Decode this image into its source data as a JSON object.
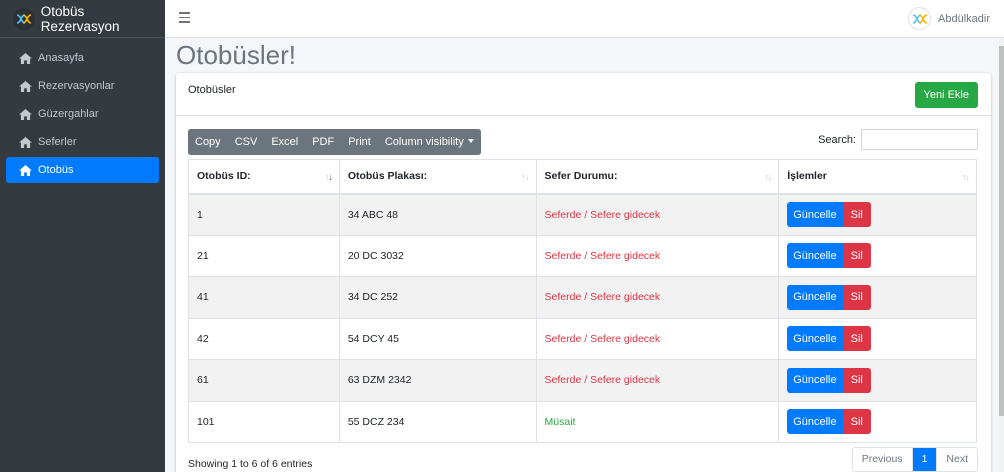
{
  "sidebar": {
    "brand": "Otobüs Rezervasyon",
    "items": [
      {
        "label": "Anasayfa"
      },
      {
        "label": "Rezervasyonlar"
      },
      {
        "label": "Güzergahlar"
      },
      {
        "label": "Seferler"
      },
      {
        "label": "Otobüs"
      }
    ]
  },
  "topbar": {
    "user_name": "Abdülkadir"
  },
  "page": {
    "title": "Otobüsler!"
  },
  "card": {
    "title": "Otobüsler",
    "add_button": "Yeni Ekle"
  },
  "toolbar": {
    "copy": "Copy",
    "csv": "CSV",
    "excel": "Excel",
    "pdf": "PDF",
    "print": "Print",
    "column_visibility": "Column visibility"
  },
  "search": {
    "label": "Search:",
    "value": ""
  },
  "table": {
    "columns": [
      "Otobüs ID:",
      "Otobüs Plakası:",
      "Sefer Durumu:",
      "İşlemler"
    ],
    "rows": [
      {
        "id": "1",
        "plate": "34 ABC 48",
        "status": "Seferde / Sefere gidecek",
        "update": "Güncelle",
        "delete": "Sil"
      },
      {
        "id": "21",
        "plate": "20 DC 3032",
        "status": "Seferde / Sefere gidecek",
        "update": "Güncelle",
        "delete": "Sil"
      },
      {
        "id": "41",
        "plate": "34 DC 252",
        "status": "Seferde / Sefere gidecek",
        "update": "Güncelle",
        "delete": "Sil"
      },
      {
        "id": "42",
        "plate": "54 DCY 45",
        "status": "Seferde / Sefere gidecek",
        "update": "Güncelle",
        "delete": "Sil"
      },
      {
        "id": "61",
        "plate": "63 DZM 2342",
        "status": "Seferde / Sefere gidecek",
        "update": "Güncelle",
        "delete": "Sil"
      },
      {
        "id": "101",
        "plate": "55 DCZ 234",
        "status": "Müsait",
        "update": "Güncelle",
        "delete": "Sil"
      }
    ]
  },
  "footer": {
    "info": "Showing 1 to 6 of 6 entries",
    "previous": "Previous",
    "page": "1",
    "next": "Next"
  },
  "colors": {
    "sidebar_bg": "#343a40",
    "primary": "#007bff",
    "success": "#28a745",
    "danger": "#dc3545",
    "secondary": "#6c757d"
  }
}
